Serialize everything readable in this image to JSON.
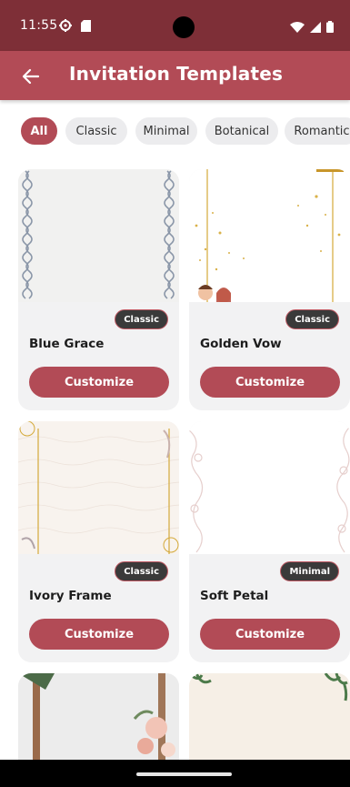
{
  "status": {
    "time": "11:55"
  },
  "app_bar": {
    "title": "Invitation Templates"
  },
  "filters": [
    {
      "label": "All"
    },
    {
      "label": "Classic"
    },
    {
      "label": "Minimal"
    },
    {
      "label": "Botanical"
    },
    {
      "label": "Romantic"
    }
  ],
  "templates": [
    {
      "name": "Blue Grace",
      "badge": "Classic",
      "button": "Customize"
    },
    {
      "name": "Golden Vow",
      "badge": "Classic",
      "button": "Customize"
    },
    {
      "name": "Ivory Frame",
      "badge": "Classic",
      "button": "Customize"
    },
    {
      "name": "Soft Petal",
      "badge": "Minimal",
      "button": "Customize"
    }
  ],
  "colors": {
    "primary": "#b24b56",
    "status_bar": "#7e2f37",
    "badge_bg": "#3a3a3a"
  },
  "icons": {
    "back": "arrow-left-icon",
    "settings": "gear-icon",
    "sd_card": "sd-card-icon",
    "wifi": "wifi-icon",
    "signal": "signal-icon",
    "battery": "battery-icon"
  }
}
